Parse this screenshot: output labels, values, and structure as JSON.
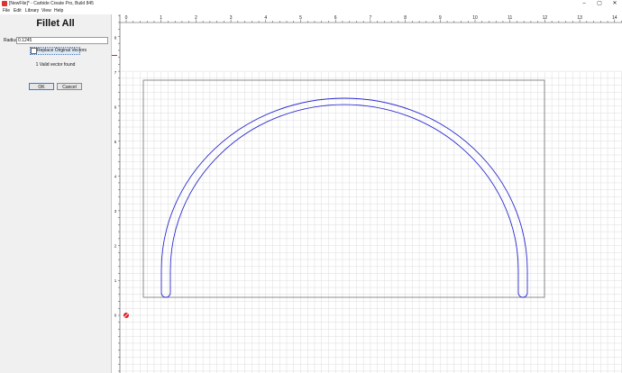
{
  "window": {
    "title": "[NewFile]* - Carbide Create Pro, Build 845",
    "minimize": "–",
    "maximize": "▢",
    "close": "✕"
  },
  "menu": [
    "File",
    "Edit",
    "Library",
    "View",
    "Help"
  ],
  "panel": {
    "title": "Fillet All",
    "radius_label": "Radius",
    "radius_value": "0.1245",
    "replace_label": "Replace Original Vectors",
    "replace_checked": false,
    "status": "1 Valid vector found",
    "ok_label": "OK",
    "cancel_label": "Cancel"
  },
  "canvas": {
    "x_ruler": [
      "0",
      "1",
      "2",
      "3",
      "4",
      "5",
      "6",
      "7",
      "8",
      "9",
      "10",
      "11",
      "12",
      "13",
      "14"
    ],
    "y_ruler": [
      "0",
      "1",
      "2",
      "3",
      "4",
      "5",
      "6",
      "7",
      "8"
    ],
    "grid_color": "#dcdcdc",
    "vector_color": "#2b2bd0",
    "stock_outline_color": "#707070",
    "origin_color": "#e02020",
    "ruler_marker_color": "#e02020"
  }
}
